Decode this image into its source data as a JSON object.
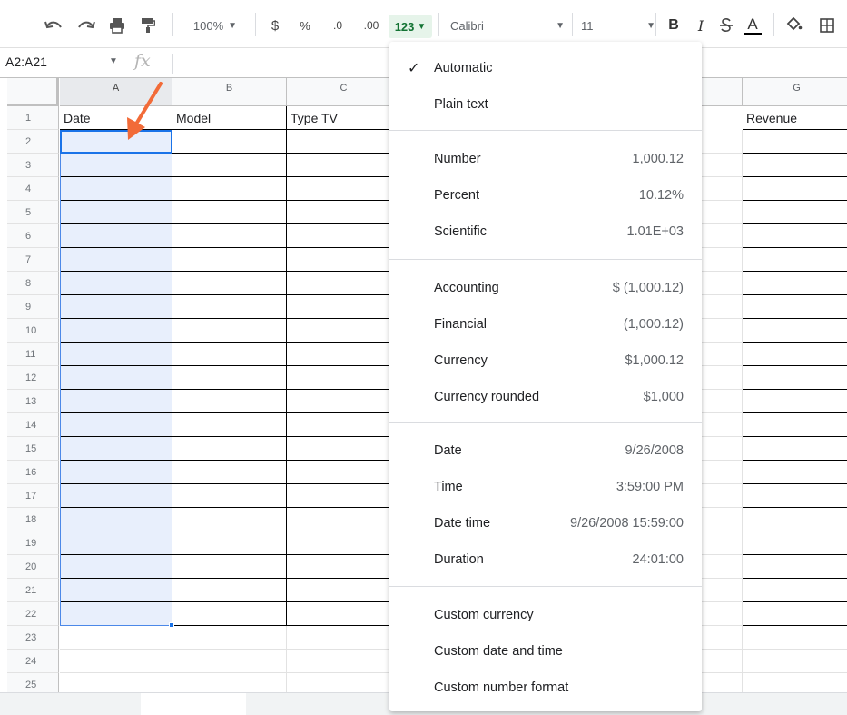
{
  "toolbar": {
    "zoom": "100%",
    "currency_symbol": "$",
    "percent_symbol": "%",
    "decrease_decimal": ".0",
    "increase_decimal": ".00",
    "more_formats": "123",
    "font": "Calibri",
    "font_size": "11",
    "bold": "B",
    "italic": "I",
    "text_color_letter": "A"
  },
  "formula_bar": {
    "name_box": "A2:A21",
    "fx": "fx"
  },
  "grid": {
    "columns": [
      "A",
      "B",
      "C",
      "G"
    ],
    "rows": [
      "1",
      "2",
      "3",
      "4",
      "5",
      "6",
      "7",
      "8",
      "9",
      "10",
      "11",
      "12",
      "13",
      "14",
      "15",
      "16",
      "17",
      "18",
      "19",
      "20",
      "21",
      "22",
      "23",
      "24",
      "25"
    ],
    "header_cells": {
      "A1": "Date",
      "B1": "Model",
      "C1": "Type TV",
      "G1": "Revenue"
    }
  },
  "format_menu": {
    "sections": [
      [
        {
          "label": "Automatic",
          "example": "",
          "checked": true
        },
        {
          "label": "Plain text",
          "example": "",
          "checked": false
        }
      ],
      [
        {
          "label": "Number",
          "example": "1,000.12"
        },
        {
          "label": "Percent",
          "example": "10.12%"
        },
        {
          "label": "Scientific",
          "example": "1.01E+03"
        }
      ],
      [
        {
          "label": "Accounting",
          "example": "$ (1,000.12)"
        },
        {
          "label": "Financial",
          "example": "(1,000.12)"
        },
        {
          "label": "Currency",
          "example": "$1,000.12"
        },
        {
          "label": "Currency rounded",
          "example": "$1,000"
        }
      ],
      [
        {
          "label": "Date",
          "example": "9/26/2008"
        },
        {
          "label": "Time",
          "example": "3:59:00 PM"
        },
        {
          "label": "Date time",
          "example": "9/26/2008 15:59:00"
        },
        {
          "label": "Duration",
          "example": "24:01:00"
        }
      ],
      [
        {
          "label": "Custom currency",
          "example": ""
        },
        {
          "label": "Custom date and time",
          "example": ""
        },
        {
          "label": "Custom number format",
          "example": ""
        }
      ]
    ]
  },
  "colors": {
    "selection_fill": "#e8effc",
    "selection_border": "#1a73e8",
    "format_button_bg": "#e6f4ea",
    "annotation_arrow": "#f26b38"
  },
  "icons": [
    "undo-icon",
    "redo-icon",
    "print-icon",
    "paint-format-icon",
    "strikethrough-icon",
    "text-color-icon",
    "fill-color-icon",
    "borders-icon",
    "check-icon",
    "annotation-arrow"
  ]
}
